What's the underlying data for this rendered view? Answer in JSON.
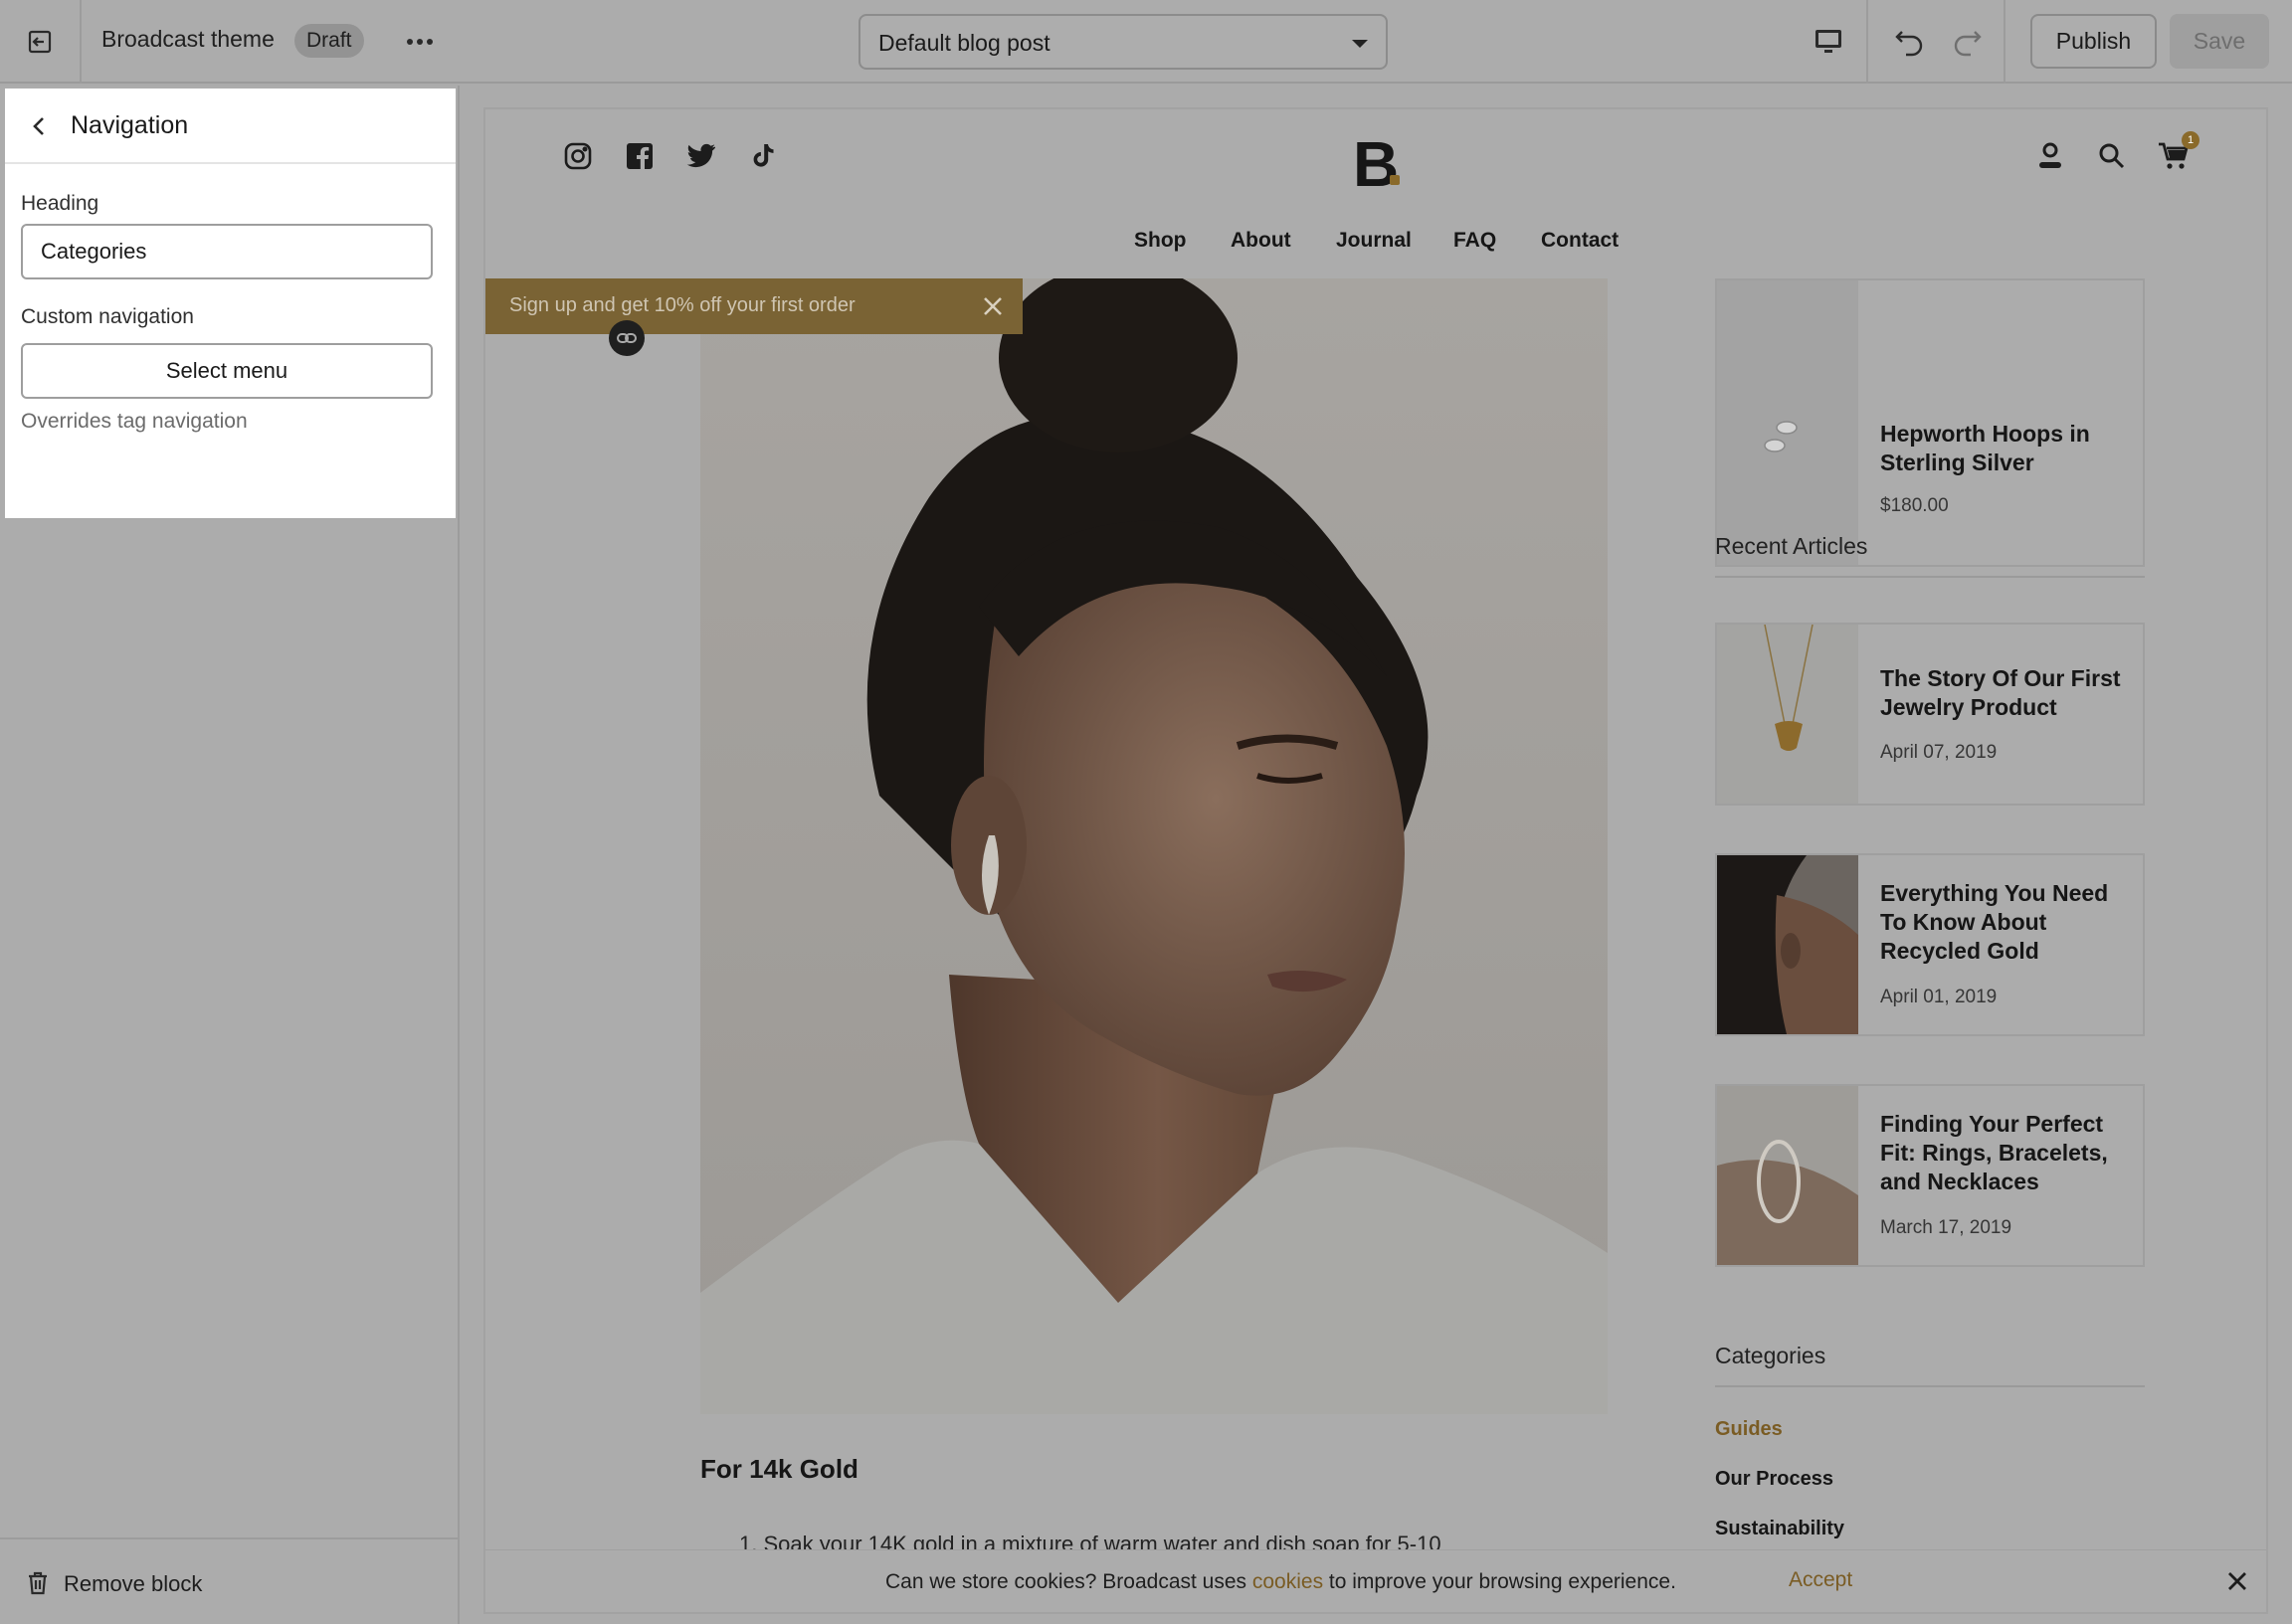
{
  "topbar": {
    "theme_name": "Broadcast theme",
    "status_badge": "Draft",
    "template_select": "Default blog post",
    "publish_label": "Publish",
    "save_label": "Save"
  },
  "sidebar": {
    "panel_title": "Navigation",
    "heading_label": "Heading",
    "heading_value": "Categories",
    "custom_nav_label": "Custom navigation",
    "select_menu_label": "Select menu",
    "help_text": "Overrides tag navigation",
    "remove_block_label": "Remove block"
  },
  "preview": {
    "logo_text": "B",
    "cart_count": "1",
    "nav": [
      "Shop",
      "About",
      "Journal",
      "FAQ",
      "Contact"
    ],
    "announcement": "Sign up and get 10% off your first order",
    "article_heading": "For 14k Gold",
    "article_list_item": "1.   Soak your 14K gold in a mixture of warm water and dish soap for 5-10",
    "product_card": {
      "title": "Hepworth Hoops in Sterling Silver",
      "price": "$180.00"
    },
    "recent_articles_heading": "Recent Articles",
    "articles": [
      {
        "title": "The Story Of Our First Jewelry Product",
        "date": "April 07, 2019"
      },
      {
        "title": "Everything You Need To Know About Recycled Gold",
        "date": "April 01, 2019"
      },
      {
        "title": "Finding Your Perfect Fit: Rings, Bracelets, and Necklaces",
        "date": "March 17, 2019"
      }
    ],
    "categories_heading": "Categories",
    "categories": [
      "Guides",
      "Our Process",
      "Sustainability"
    ],
    "cookie": {
      "text_before": "Can we store cookies?   Broadcast uses ",
      "link": "cookies",
      "text_after": " to improve your browsing experience.",
      "accept": "Accept"
    }
  },
  "icons": {
    "exit": "exit-icon",
    "more": "more-icon",
    "device": "desktop-icon",
    "undo": "undo-icon",
    "redo": "redo-icon",
    "back": "chevron-left-icon",
    "trash": "trash-icon",
    "close": "close-icon",
    "link": "link-icon",
    "instagram": "instagram-icon",
    "facebook": "facebook-icon",
    "twitter": "twitter-icon",
    "tiktok": "tiktok-icon",
    "account": "account-icon",
    "search": "search-icon",
    "cart": "cart-icon"
  },
  "colors": {
    "accent_gold": "#7a5c24",
    "announcement_bg": "#7a6334",
    "overlay_gray": "#acacac"
  }
}
